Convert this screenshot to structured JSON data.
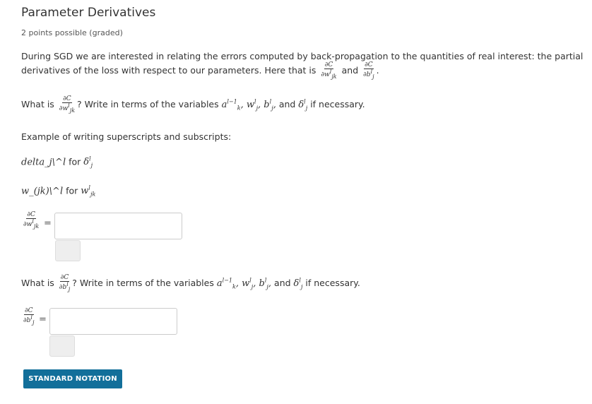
{
  "problem": {
    "title": "Parameter Derivatives",
    "points": "2 points possible (graded)"
  },
  "intro": {
    "line1": "During SGD we are interested in relating the errors computed by back-propagation to the quantities of real interest: the partial",
    "line2_prefix": "derivatives of the loss with respect to our parameters. Here that is",
    "and": "and",
    "end": "."
  },
  "q1": {
    "prefix": "What is",
    "suffix": "? Write in terms of the variables",
    "vars_and": "and",
    "vars_tail": "if necessary.",
    "input_value": "",
    "input_placeholder": ""
  },
  "examples": {
    "heading": "Example of writing superscripts and subscripts:",
    "ex1_code": "delta_j\\^l",
    "ex1_for": "for",
    "ex2_code": "w_(jk)\\^l",
    "ex2_for": "for"
  },
  "q2": {
    "prefix": "What is",
    "suffix": "? Write in terms of the variables",
    "vars_and": "and",
    "vars_tail": "if necessary.",
    "input_value": "",
    "input_placeholder": ""
  },
  "footer": {
    "notation_button": "STANDARD NOTATION"
  },
  "colors": {
    "button_bg": "#126f9a",
    "button_text": "#ffffff",
    "input_border": "#cccccc",
    "check_bg": "#eeeeee"
  }
}
